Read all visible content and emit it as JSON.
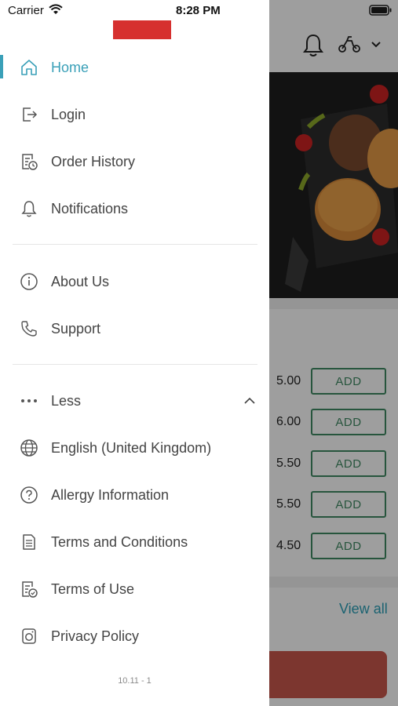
{
  "status_bar": {
    "carrier": "Carrier",
    "time": "8:28 PM"
  },
  "menu": {
    "primary": [
      {
        "label": "Home",
        "icon": "home-icon",
        "active": true
      },
      {
        "label": "Login",
        "icon": "login-icon"
      },
      {
        "label": "Order History",
        "icon": "order-history-icon"
      },
      {
        "label": "Notifications",
        "icon": "bell-icon"
      }
    ],
    "secondary": [
      {
        "label": "About Us",
        "icon": "info-icon"
      },
      {
        "label": "Support",
        "icon": "phone-icon"
      }
    ],
    "more": {
      "toggle_label": "Less",
      "items": [
        {
          "label": "English (United Kingdom)",
          "icon": "globe-icon"
        },
        {
          "label": "Allergy Information",
          "icon": "question-icon"
        },
        {
          "label": "Terms and Conditions",
          "icon": "document-icon"
        },
        {
          "label": "Terms of Use",
          "icon": "document-check-icon"
        },
        {
          "label": "Privacy Policy",
          "icon": "privacy-icon"
        }
      ]
    },
    "version": "10.11 - 1"
  },
  "background": {
    "products": [
      {
        "price": "5.00",
        "button": "ADD"
      },
      {
        "price": "6.00",
        "button": "ADD"
      },
      {
        "price": "5.50",
        "button": "ADD"
      },
      {
        "price": "5.50",
        "button": "ADD"
      },
      {
        "price": "4.50",
        "button": "ADD"
      }
    ],
    "view_all": "View all"
  },
  "colors": {
    "accent": "#3aa0b8",
    "add_button": "#3f8a63",
    "brand_red": "#d6302f",
    "cta": "#c9574d"
  }
}
